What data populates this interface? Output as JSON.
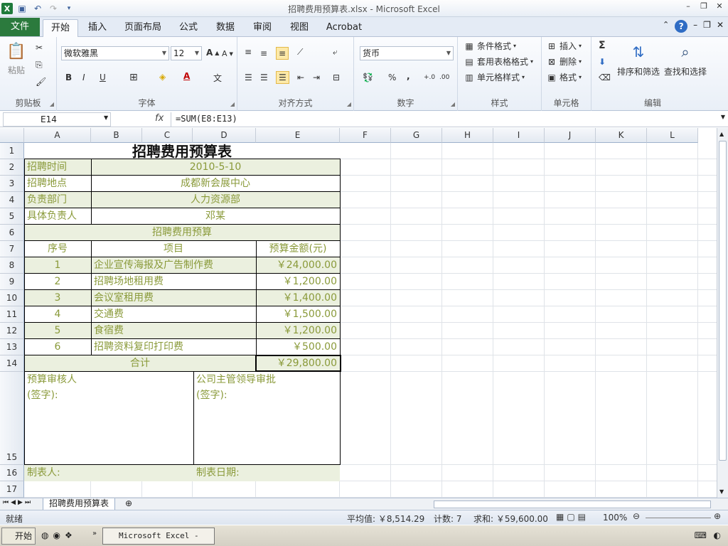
{
  "window": {
    "title": "招聘费用预算表.xlsx  -  Microsoft Excel",
    "logo": "X"
  },
  "tabs": [
    "文件",
    "开始",
    "插入",
    "页面布局",
    "公式",
    "数据",
    "审阅",
    "视图",
    "Acrobat"
  ],
  "ribbon": {
    "clipboard": {
      "label": "剪贴板",
      "paste": "粘贴"
    },
    "font": {
      "label": "字体",
      "name": "微软雅黑",
      "size": "12",
      "bold": "B",
      "italic": "I",
      "underline": "U"
    },
    "alignment": {
      "label": "对齐方式"
    },
    "number": {
      "label": "数字",
      "format": "货币",
      "percent": "%",
      "comma": ",",
      "inc": "+.0",
      "dec": ".00"
    },
    "styles": {
      "label": "样式",
      "cond": "条件格式",
      "table": "套用表格格式",
      "cell": "单元格样式"
    },
    "cells": {
      "label": "单元格",
      "insert": "插入",
      "delete": "删除",
      "format": "格式"
    },
    "editing": {
      "label": "编辑",
      "sort": "排序和筛选",
      "find": "查找和选择",
      "sigma": "Σ"
    }
  },
  "formula_bar": {
    "name_box": "E14",
    "fx": "fx",
    "formula": "=SUM(E8:E13)"
  },
  "columns": [
    "A",
    "B",
    "C",
    "D",
    "E",
    "F",
    "G",
    "H",
    "I",
    "J",
    "K",
    "L"
  ],
  "rows": [
    "1",
    "2",
    "3",
    "4",
    "5",
    "6",
    "7",
    "8",
    "9",
    "10",
    "11",
    "12",
    "13",
    "14",
    "15",
    "16",
    "17"
  ],
  "sheet": {
    "title": "招聘费用预算表",
    "info": [
      {
        "label": "招聘时间",
        "value": "2010-5-10"
      },
      {
        "label": "招聘地点",
        "value": "成都新会展中心"
      },
      {
        "label": "负责部门",
        "value": "人力资源部"
      },
      {
        "label": "具体负责人",
        "value": "邓某"
      }
    ],
    "section": "招聘费用预算",
    "headers": [
      "序号",
      "项目",
      "预算金额(元)"
    ],
    "items": [
      {
        "no": "1",
        "name": "企业宣传海报及广告制作费",
        "amount": "￥24,000.00"
      },
      {
        "no": "2",
        "name": "招聘场地租用费",
        "amount": "￥1,200.00"
      },
      {
        "no": "3",
        "name": "会议室租用费",
        "amount": "￥1,400.00"
      },
      {
        "no": "4",
        "name": "交通费",
        "amount": "￥1,500.00"
      },
      {
        "no": "5",
        "name": "食宿费",
        "amount": "￥1,200.00"
      },
      {
        "no": "6",
        "name": "招聘资料复印打印费",
        "amount": "￥500.00"
      }
    ],
    "total_label": "合计",
    "total_value": "￥29,800.00",
    "reviewer": "预算审核人",
    "reviewer_sign": "(签字):",
    "approver": "公司主管领导审批",
    "approver_sign": "(签字):",
    "maker": "制表人:",
    "date_label": "制表日期:"
  },
  "sheet_tab": "招聘费用预算表",
  "status": {
    "ready": "就绪",
    "average": "平均值: ￥8,514.29",
    "count": "计数: 7",
    "sum": "求和: ￥59,600.00",
    "zoom": "100%"
  },
  "taskbar": {
    "start": "开始",
    "app": "Microsoft Excel - ..."
  }
}
